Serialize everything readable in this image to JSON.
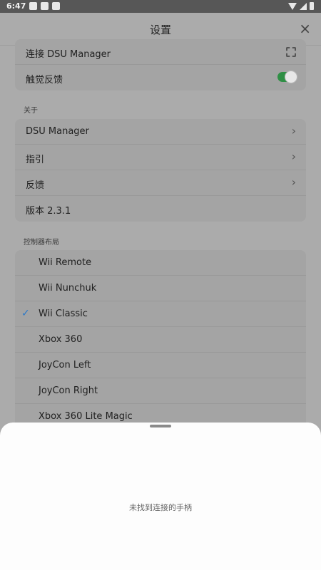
{
  "statusbar": {
    "time": "6:47"
  },
  "header": {
    "title": "设置",
    "close_label": "×"
  },
  "connection": {
    "items": [
      {
        "label": "连接 DSU Manager",
        "icon": "scan-icon"
      },
      {
        "label": "触觉反馈",
        "toggle_on": true
      }
    ]
  },
  "about": {
    "heading": "关于",
    "items": [
      {
        "label": "DSU Manager"
      },
      {
        "label": "指引"
      },
      {
        "label": "反馈"
      },
      {
        "label": "版本 2.3.1"
      }
    ]
  },
  "layout": {
    "heading": "控制器布局",
    "items": [
      {
        "label": "Wii Remote",
        "selected": false
      },
      {
        "label": "Wii Nunchuk",
        "selected": false
      },
      {
        "label": "Wii Classic",
        "selected": true
      },
      {
        "label": "Xbox 360",
        "selected": false
      },
      {
        "label": "JoyCon Left",
        "selected": false
      },
      {
        "label": "JoyCon Right",
        "selected": false
      },
      {
        "label": "Xbox 360 Lite Magic",
        "selected": false
      }
    ]
  },
  "sheet": {
    "message": "未找到连接的手柄"
  },
  "colors": {
    "accent": "#2a78c8",
    "toggle": "#2f8f45"
  }
}
